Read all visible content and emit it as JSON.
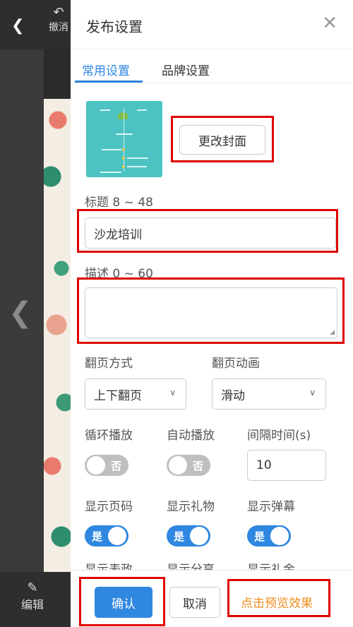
{
  "editor": {
    "undo_label": "撤消",
    "edit_label": "编辑"
  },
  "panel": {
    "title": "发布设置",
    "tabs": [
      {
        "label": "常用设置",
        "active": true
      },
      {
        "label": "品牌设置",
        "active": false
      }
    ],
    "change_cover_label": "更改封面",
    "title_label": "标题 8 ~ 48",
    "title_value": "沙龙培训",
    "desc_label": "描述 0 ~ 60",
    "desc_value": "",
    "page_turn_label": "翻页方式",
    "page_turn_value": "上下翻页",
    "page_anim_label": "翻页动画",
    "page_anim_value": "滑动",
    "loop_label": "循环播放",
    "loop_state": "否",
    "autoplay_label": "自动播放",
    "autoplay_state": "否",
    "interval_label": "间隔时间(s)",
    "interval_value": "10",
    "show_page_label": "显示页码",
    "show_page_state": "是",
    "show_gift_label": "显示礼物",
    "show_gift_state": "是",
    "show_danmu_label": "显示弹幕",
    "show_danmu_state": "是",
    "more_labels": [
      "显示表政",
      "显示分享",
      "显示礼金"
    ]
  },
  "footer": {
    "confirm_label": "确认",
    "cancel_label": "取消",
    "preview_label": "点击预览效果"
  },
  "colors": {
    "accent": "#2f87e0",
    "highlight_box": "#e00000",
    "preview_text": "#f08c1a"
  }
}
